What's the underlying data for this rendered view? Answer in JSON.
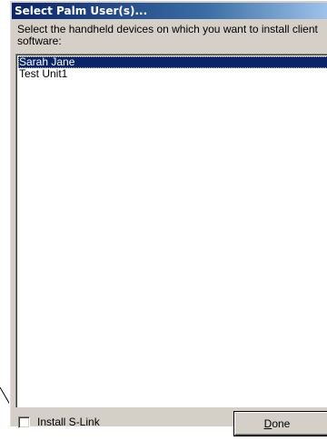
{
  "dialog": {
    "title": "Select Palm User(s)...",
    "instruction": "Select the handheld devices on which you want to install client software:",
    "users": [
      {
        "label": "Sarah Jane",
        "selected": true
      },
      {
        "label": "Test Unit1",
        "selected": false
      }
    ],
    "install_checkbox": {
      "label": "Install S-Link",
      "checked": false
    },
    "done_button": {
      "mnemonic": "D",
      "rest": "one"
    }
  },
  "colors": {
    "dialog_bg": "#d4d0c8",
    "title_bg": "#0a246a",
    "selection_bg": "#0a246a"
  }
}
